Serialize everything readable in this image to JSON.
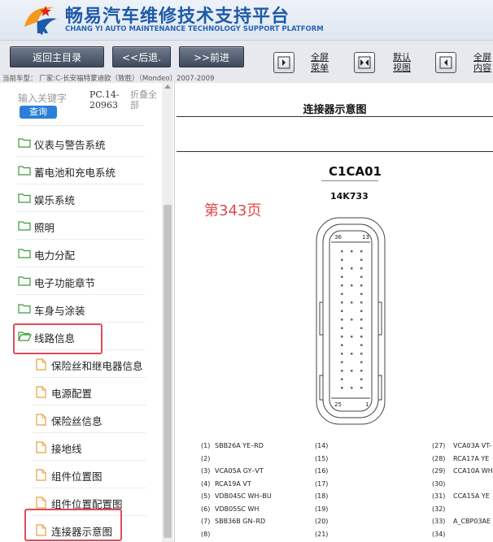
{
  "header": {
    "title": "畅易汽车维修技术支持平台",
    "subtitle": "CHANG YI AUTO MAINTENANCE TECHNOLOGY SUPPORT PLATFORM"
  },
  "toolbar": {
    "home_label": "返回主目录",
    "back_label": "<<后退.",
    "forward_label": ">>前进",
    "fullscreen_menu": [
      "全屏",
      "菜单"
    ],
    "default_view": [
      "默认",
      "视图"
    ],
    "fullscreen_content": [
      "全屏",
      "内容"
    ]
  },
  "vehicle_bar": "当前车型：  厂家:C-长安福特蒙迪欧（致胜）（Mondeo）2007-2009",
  "sidebar": {
    "search_placeholder": "输入关键字",
    "query_label": "查询",
    "code_label": [
      "PC.14-",
      "20963"
    ],
    "collapse_label": [
      "折叠全",
      "部"
    ],
    "items": [
      {
        "label": "仪表与警告系统",
        "level": 1,
        "icon": "folder-icon"
      },
      {
        "label": "蓄电池和充电系统",
        "level": 1,
        "icon": "folder-icon"
      },
      {
        "label": "娱乐系统",
        "level": 1,
        "icon": "folder-icon"
      },
      {
        "label": "照明",
        "level": 1,
        "icon": "folder-icon"
      },
      {
        "label": "电力分配",
        "level": 1,
        "icon": "folder-icon"
      },
      {
        "label": "电子功能章节",
        "level": 1,
        "icon": "folder-icon"
      },
      {
        "label": "车身与涂装",
        "level": 1,
        "icon": "folder-icon"
      },
      {
        "label": "线路信息",
        "level": 1,
        "icon": "folder-open-icon"
      },
      {
        "label": "保险丝和继电器信息",
        "level": 2,
        "icon": "document-icon"
      },
      {
        "label": "电源配置",
        "level": 2,
        "icon": "document-icon"
      },
      {
        "label": "保险丝信息",
        "level": 2,
        "icon": "document-icon"
      },
      {
        "label": "接地线",
        "level": 2,
        "icon": "document-icon"
      },
      {
        "label": "组件位置图",
        "level": 2,
        "icon": "document-icon"
      },
      {
        "label": "组件位置配置图",
        "level": 2,
        "icon": "document-icon"
      },
      {
        "label": "连接器示意图",
        "level": 2,
        "icon": "document-icon"
      }
    ]
  },
  "main": {
    "doc_title": "连接器示意图",
    "connector_id": "C1CA01",
    "part_number": "14K733",
    "page_note": "第343页",
    "pin_labels": {
      "top_left": "36",
      "top_right": "13",
      "bottom_left": "25",
      "bottom_right": "1"
    },
    "pins_col1": [
      {
        "n": "(1)",
        "v": "SBB26A YE–RD"
      },
      {
        "n": "(2)",
        "v": ""
      },
      {
        "n": "(3)",
        "v": "VCA05A GY–VT"
      },
      {
        "n": "(4)",
        "v": "RCA19A VT"
      },
      {
        "n": "(5)",
        "v": "VDB04SC WH–BU"
      },
      {
        "n": "(6)",
        "v": "VDB05SC WH"
      },
      {
        "n": "(7)",
        "v": "SBB36B GN–RD"
      },
      {
        "n": "(8)",
        "v": ""
      }
    ],
    "pins_col2": [
      "(14)",
      "(15)",
      "(16)",
      "(17)",
      "(18)",
      "(19)",
      "(20)",
      "(21)"
    ],
    "pins_col3": [
      {
        "n": "(27)",
        "v": "VCA03A VT-"
      },
      {
        "n": "(28)",
        "v": "RCA17A YE"
      },
      {
        "n": "(29)",
        "v": "CCA10A WH"
      },
      {
        "n": "(30)",
        "v": ""
      },
      {
        "n": "(31)",
        "v": "CCA15A YE"
      },
      {
        "n": "(32)",
        "v": ""
      },
      {
        "n": "(33)",
        "v": "A_CBP03AE"
      },
      {
        "n": "(34)",
        "v": ""
      }
    ]
  },
  "colors": {
    "brand": "#1d5aa8",
    "highlight": "#e04a5a",
    "page_note": "#e04a4a"
  }
}
